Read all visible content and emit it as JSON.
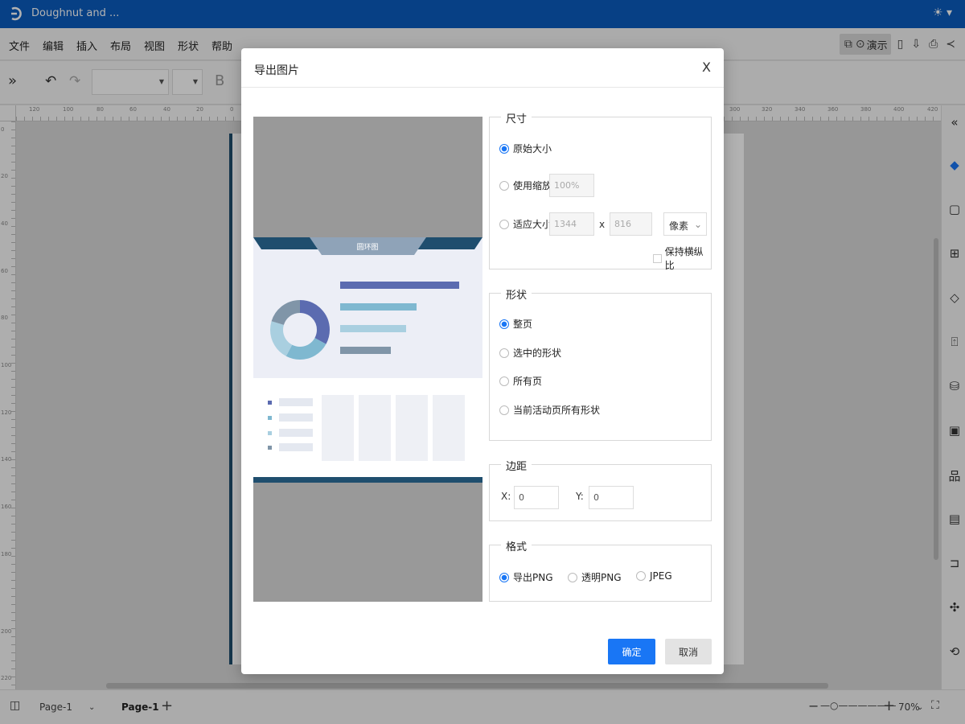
{
  "window": {
    "title": "Doughnut and ..."
  },
  "menu": [
    "文件",
    "编辑",
    "插入",
    "布局",
    "视图",
    "形状",
    "帮助"
  ],
  "toolbar": {
    "present_label": "演示",
    "bold_label": "B"
  },
  "ruler_top_labels": [
    "120",
    "100",
    "80",
    "60",
    "40",
    "20",
    "0",
    "300",
    "320",
    "340",
    "360",
    "380",
    "400",
    "420"
  ],
  "ruler_left_labels": [
    "0",
    "20",
    "40",
    "60",
    "80",
    "100",
    "120",
    "140",
    "160",
    "180",
    "200",
    "220"
  ],
  "dialog": {
    "title": "导出图片",
    "close": "X",
    "preview_title": "圆环图",
    "size": {
      "title": "尺寸",
      "original": "原始大小",
      "scale": "使用缩放",
      "scale_value": "100%",
      "fit": "适应大小",
      "width": "1344",
      "x": "x",
      "height": "816",
      "unit": "像素",
      "keep_ratio": "保持横纵比"
    },
    "shape": {
      "title": "形状",
      "options": [
        "整页",
        "选中的形状",
        "所有页",
        "当前活动页所有形状"
      ]
    },
    "margin": {
      "title": "边距",
      "x_label": "X:",
      "x_value": "0",
      "y_label": "Y:",
      "y_value": "0"
    },
    "format": {
      "title": "格式",
      "options": [
        "导出PNG",
        "透明PNG",
        "JPEG"
      ]
    },
    "ok": "确定",
    "cancel": "取消"
  },
  "bottom": {
    "page_select": "Page-1",
    "page_tab": "Page-1",
    "zoom": "70%"
  },
  "colors": {
    "brand": "#0b5cbf",
    "primary": "#1976f5"
  }
}
